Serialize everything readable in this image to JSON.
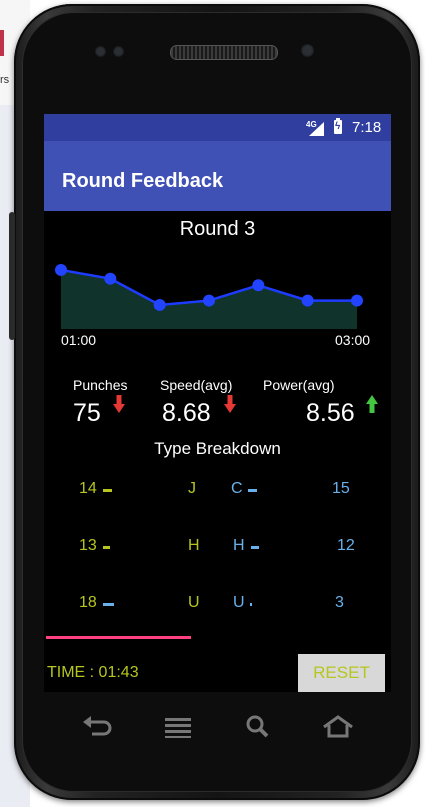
{
  "background": {
    "left_text": "rs"
  },
  "status_bar": {
    "network": "4G",
    "time": "7:18"
  },
  "app_bar": {
    "title": "Round Feedback"
  },
  "round": {
    "title": "Round 3"
  },
  "chart_data": {
    "type": "area",
    "x": [
      1,
      2,
      3,
      4,
      5,
      6,
      7
    ],
    "values": [
      9.3,
      8.9,
      7.7,
      7.9,
      8.6,
      7.9,
      7.9
    ],
    "x_start_label": "01:00",
    "x_end_label": "03:00",
    "line_color": "#1e3cff",
    "fill_color": "#10332b",
    "point_color": "#2244ff",
    "ylim": [
      6.6,
      9.8
    ]
  },
  "stats": {
    "punches": {
      "label": "Punches",
      "value": "75",
      "trend": "down"
    },
    "speed": {
      "label": "Speed(avg)",
      "value": "8.68",
      "trend": "down"
    },
    "power": {
      "label": "Power(avg)",
      "value": "8.56",
      "trend": "up"
    }
  },
  "breakdown": {
    "title": "Type Breakdown",
    "rows": [
      {
        "left_count": "14",
        "left_type": "J",
        "right_type": "C",
        "right_count": "15"
      },
      {
        "left_count": "13",
        "left_type": "H",
        "right_type": "H",
        "right_count": "12"
      },
      {
        "left_count": "18",
        "left_type": "U",
        "right_type": "U",
        "right_count": "3"
      }
    ]
  },
  "footer": {
    "time_label": "TIME : 01:43",
    "reset_label": "RESET"
  },
  "colors": {
    "status_bar": "#303f9f",
    "app_bar": "#3f51b5",
    "accent_yellow": "#b6c61e",
    "accent_blue": "#6ab0ea",
    "divider": "#ff4081",
    "arrow_down": "#e53935",
    "arrow_up": "#43c640"
  }
}
